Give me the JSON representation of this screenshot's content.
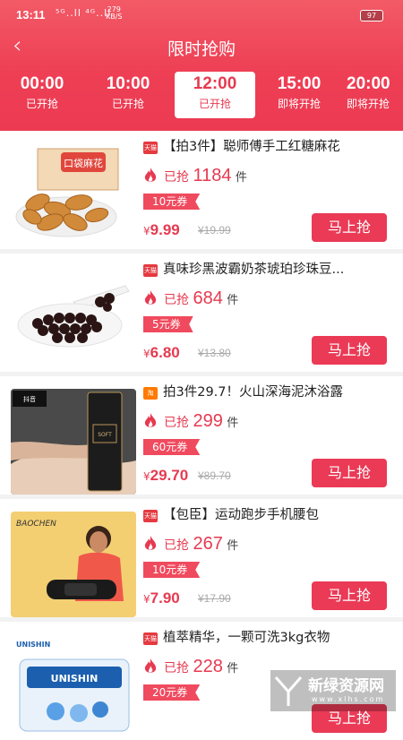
{
  "status": {
    "time": "13:11",
    "signal": "⁵ᴳ..ll ⁴ᴳ..ll",
    "net_speed": "279",
    "net_unit": "KB/S",
    "battery": "97"
  },
  "nav": {
    "title": "限时抢购",
    "back_icon": "chevron-left-icon"
  },
  "slots": [
    {
      "time": "00:00",
      "status": "已开抢"
    },
    {
      "time": "10:00",
      "status": "已开抢"
    },
    {
      "time": "12:00",
      "status": "已开抢",
      "active": true
    },
    {
      "time": "15:00",
      "status": "即将开抢"
    },
    {
      "time": "20:00",
      "status": "即将开抢"
    }
  ],
  "common": {
    "sold_prefix": "已抢",
    "sold_unit": "件",
    "buy_label": "马上抢",
    "currency": "¥"
  },
  "products": [
    {
      "platform": "天猫",
      "title": "【拍3件】聪师傅手工红糖麻花",
      "sold": "1184",
      "coupon": "10元券",
      "price": "9.99",
      "original": "¥19.99",
      "image": "mahua-snack"
    },
    {
      "platform": "天猫",
      "title": "真味珍黑波霸奶茶琥珀珍珠豆...",
      "sold": "684",
      "coupon": "5元券",
      "price": "6.80",
      "original": "¥13.80",
      "image": "tapioca-pearls"
    },
    {
      "platform": "淘",
      "title": "拍3件29.7！火山深海泥沐浴露",
      "sold": "299",
      "coupon": "60元券",
      "price": "29.70",
      "original": "¥89.70",
      "image": "body-wash"
    },
    {
      "platform": "天猫",
      "title": "【包臣】运动跑步手机腰包",
      "sold": "267",
      "coupon": "10元券",
      "price": "7.90",
      "original": "¥17.90",
      "image": "waist-bag"
    },
    {
      "platform": "天猫",
      "title": "植萃精华，一颗可洗3kg衣物",
      "sold": "228",
      "coupon": "20元券",
      "price": "",
      "original": "",
      "image": "laundry-pods"
    }
  ],
  "watermark": {
    "text": "新绿资源网",
    "url": "www.xlhs.com"
  }
}
